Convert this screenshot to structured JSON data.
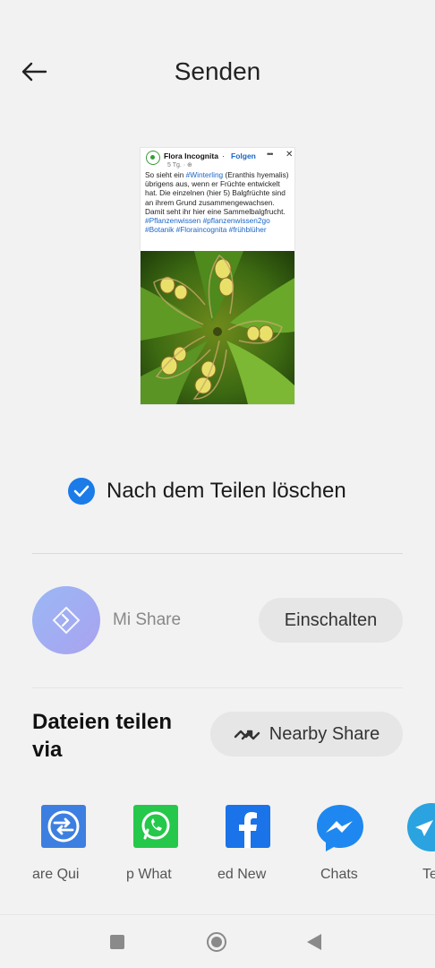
{
  "header": {
    "title": "Senden",
    "back_icon": "arrow-left-icon"
  },
  "preview": {
    "page_name": "Flora Incognita",
    "separator": "·",
    "follow_label": "Folgen",
    "date": "5 Tg. · ⊕",
    "text_parts": [
      "So sieht ein ",
      "#Winterling",
      " (Eranthis hyemalis) übrigens aus, wenn er Früchte entwickelt hat. Die einzelnen (hier 5) Balgfrüchte sind an ihrem Grund zusammengewachsen. Damit seht ihr hier eine Sammelbalgfrucht.",
      "#Pflanzenwissen #pflanzenwissen2go #Botanik #Floraincognita #frühblüher"
    ]
  },
  "options": {
    "delete_after_share": "Nach dem Teilen löschen",
    "delete_checked": true,
    "check_color": "#1a7be9"
  },
  "mi_share": {
    "label": "Mi Share",
    "button_label": "Einschalten"
  },
  "share_via": {
    "title": "Dateien teilen via",
    "nearby_label": "Nearby Share"
  },
  "apps": [
    {
      "label": "are   Qui",
      "icon": "quick-share-icon"
    },
    {
      "label": "p   What",
      "icon": "whatsapp-icon"
    },
    {
      "label": "ed   New",
      "icon": "facebook-icon"
    },
    {
      "label": "Chats",
      "icon": "messenger-icon"
    },
    {
      "label": "Te",
      "icon": "telegram-icon"
    }
  ],
  "navbar": {
    "recent_icon": "square-icon",
    "home_icon": "circle-icon",
    "back_icon": "triangle-back-icon"
  }
}
